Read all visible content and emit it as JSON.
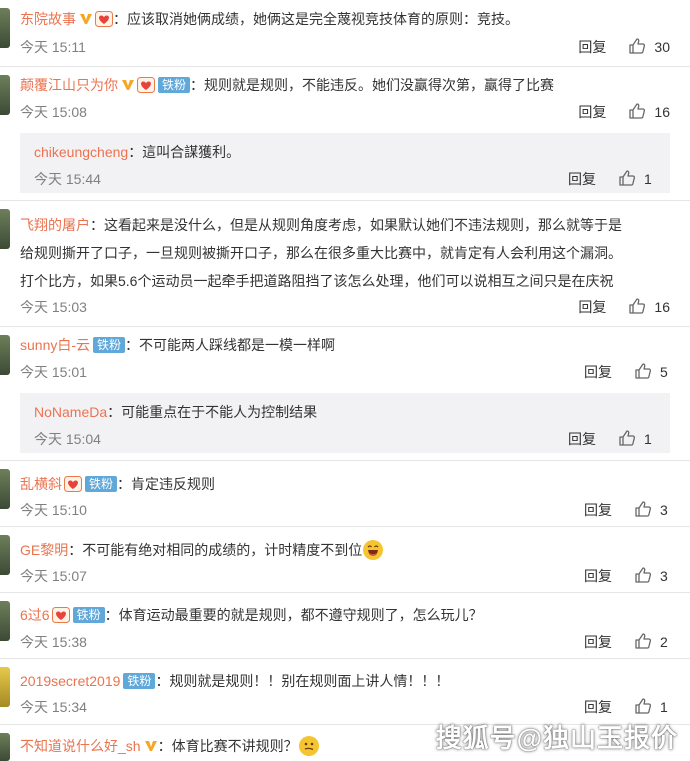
{
  "actions": {
    "reply_label": "回复"
  },
  "comments": [
    {
      "user": "东院故事",
      "text": "：应该取消她俩成绩，她俩这是完全蔑视竞技体育的原则：竞技。",
      "time": "今天 15:11",
      "likes": "30"
    },
    {
      "user": "颠覆江山只为你",
      "fan_label": "铁粉",
      "text": "：规则就是规则，不能违反。她们没赢得次第，赢得了比赛",
      "time": "今天 15:08",
      "likes": "16",
      "reply": {
        "user": "chikeungcheng",
        "text": "：這叫合謀獲利。",
        "time": "今天 15:44",
        "likes": "1"
      }
    },
    {
      "user": "飞翔的屠户",
      "text_lines": [
        "：这看起来是没什么，但是从规则角度考虑，如果默认她们不违法规则，那么就等于是",
        "给规则撕开了口子，一旦规则被撕开口子，那么在很多重大比赛中，就肯定有人会利用这个漏洞。",
        "打个比方，如果5.6个运动员一起牵手把道路阻挡了该怎么处理，他们可以说相互之间只是在庆祝"
      ],
      "time": "今天 15:03",
      "likes": "16"
    },
    {
      "user": "sunny白-云",
      "fan_label": "铁粉",
      "text": "：不可能两人踩线都是一模一样啊",
      "time": "今天 15:01",
      "likes": "5",
      "reply": {
        "user": "NoNameDa",
        "text": "：可能重点在于不能人为控制结果",
        "time": "今天 15:04",
        "likes": "1"
      }
    },
    {
      "user": "乱横斜",
      "fan_label": "铁粉",
      "text": "：肯定违反规则",
      "time": "今天 15:10",
      "likes": "3"
    },
    {
      "user": "GE黎明",
      "text": "：不可能有绝对相同的成绩的，计时精度不到位",
      "time": "今天 15:07",
      "likes": "3"
    },
    {
      "user": "6过6",
      "fan_label": "铁粉",
      "text": "：体育运动最重要的就是规则，都不遵守规则了，怎么玩儿？",
      "time": "今天 15:38",
      "likes": "2"
    },
    {
      "user": "2019secret2019",
      "fan_label": "铁粉",
      "text": "：规则就是规则！！别在规则面上讲人情！！！",
      "time": "今天 15:34",
      "likes": "1"
    },
    {
      "user": "不知道说什么好_sh",
      "text": "：体育比赛不讲规则？"
    }
  ],
  "watermark": "搜狐号@独山玉报价",
  "colors": {
    "username": "#eb7350",
    "fan_badge": "#5fa8d9",
    "time": "#808080",
    "reply_bg": "#f2f2f5"
  },
  "icons": [
    "verified-v-icon",
    "heart-member-icon",
    "thumb-up-icon",
    "laugh-emoji-icon",
    "think-emoji-icon"
  ]
}
